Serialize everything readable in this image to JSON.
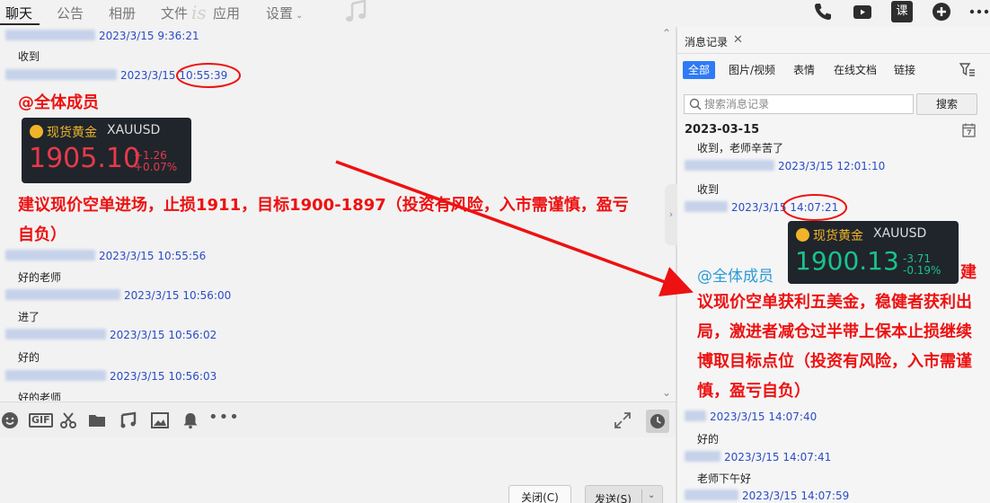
{
  "top_tabs": [
    "聊天",
    "公告",
    "相册",
    "文件",
    "应用",
    "设置"
  ],
  "top_deco": "is",
  "top_icons": [
    "phone-icon",
    "video-icon",
    "classroom-icon",
    "add-icon",
    "more-icon"
  ],
  "top_classroom_label": "课",
  "chat": {
    "messages": [
      {
        "time": "2023/3/15 9:36:21",
        "text": "收到"
      },
      {
        "time": "2023/3/15 10:55:39",
        "at": "@全体成员",
        "card": {
          "name": "现货黄金",
          "symbol": "XAUUSD",
          "price": "1905.10",
          "change": "+1.26",
          "pct": "+0.07%"
        },
        "line1": "建议现价空单进场，止损1911，目标1900-1897（投资有风险，入市需谨慎，盈亏",
        "line2": "自负）"
      },
      {
        "time": "2023/3/15 10:55:56",
        "text": "好的老师"
      },
      {
        "time": "2023/3/15 10:56:00",
        "text": "进了"
      },
      {
        "time": "2023/3/15 10:56:02",
        "text": "好的"
      },
      {
        "time": "2023/3/15 10:56:03",
        "text": "好的老师"
      }
    ]
  },
  "toolbar": {
    "gif_label": "GIF",
    "icons": [
      "emoji-icon",
      "gif-icon",
      "scissors-icon",
      "folder-icon",
      "music-icon",
      "image-icon",
      "bell-icon",
      "more-icon",
      "expand-icon",
      "history-clock-icon"
    ]
  },
  "input": {
    "close_label": "关闭(C)",
    "send_label": "发送(S)"
  },
  "history": {
    "tab_label": "消息记录",
    "filters": [
      "全部",
      "图片/视频",
      "表情",
      "在线文档",
      "链接"
    ],
    "search_placeholder": "搜索消息记录",
    "search_button": "搜索",
    "date": "2023-03-15",
    "entries": [
      {
        "text": "收到，老师辛苦了"
      },
      {
        "time": "2023/3/15 12:01:10",
        "text": "收到"
      },
      {
        "time": "2023/3/15 14:07:21",
        "at": "@全体成员",
        "card": {
          "name": "现货黄金",
          "symbol": "XAUUSD",
          "price": "1900.13",
          "change": "-3.71",
          "pct": "-0.19%"
        },
        "lines": [
          "建",
          "议现价空单获利五美金，稳健者获利出",
          "局，激进者减仓过半带上保本止损继续",
          "博取目标点位（投资有风险，入市需谨",
          "慎，盈亏自负）"
        ]
      },
      {
        "time": "2023/3/15 14:07:40",
        "text": "好的"
      },
      {
        "time": "2023/3/15 14:07:41",
        "text": "老师下午好"
      },
      {
        "time": "2023/3/15 14:07:59"
      }
    ]
  },
  "colors": {
    "accent_red": "#ee1111",
    "link_blue": "#2a4cc7",
    "filter_active": "#2f7bf5",
    "gold": "#f0b429",
    "up_red": "#e8394b",
    "down_green": "#1bc28b"
  }
}
